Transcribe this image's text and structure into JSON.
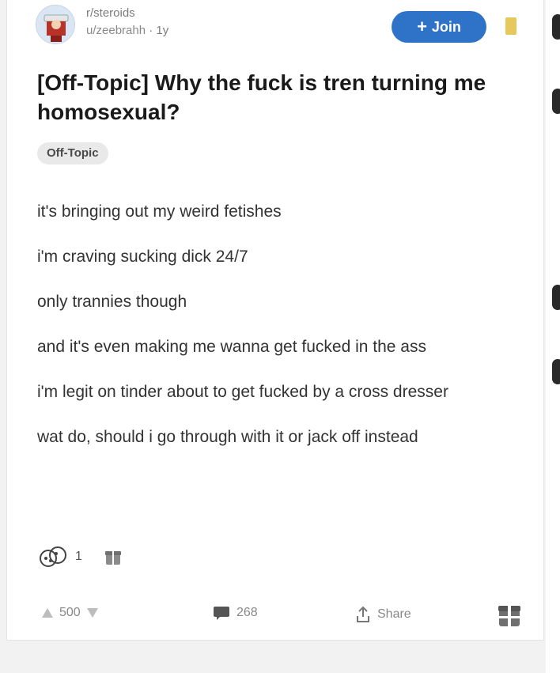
{
  "post": {
    "subreddit": "r/steroids",
    "author": "u/zeebrahh",
    "age": "1y",
    "join_label": "Join",
    "title": "[Off-Topic] Why the fuck is tren turning me homosexual?",
    "flair": "Off-Topic",
    "body": [
      "it's bringing out my weird fetishes",
      "i'm craving sucking dick 24/7",
      "only trannies though",
      "and it's even making me wanna get fucked in the ass",
      "i'm legit on tinder about to get fucked by a cross dresser",
      "wat do, should i go through with it or jack off instead"
    ],
    "award_count": "1",
    "votes": "500",
    "comments": "268",
    "share_label": "Share"
  },
  "icons": {
    "join": "plus-icon",
    "save": "bookmark-icon",
    "award": "award-icon",
    "gift": "gift-icon",
    "upvote": "upvote-icon",
    "downvote": "downvote-icon",
    "comment": "comment-icon",
    "share": "share-icon"
  },
  "colors": {
    "join_button": "#2f73c8",
    "save_icon": "#e6c85c",
    "flair_bg": "#e9e9e9"
  }
}
